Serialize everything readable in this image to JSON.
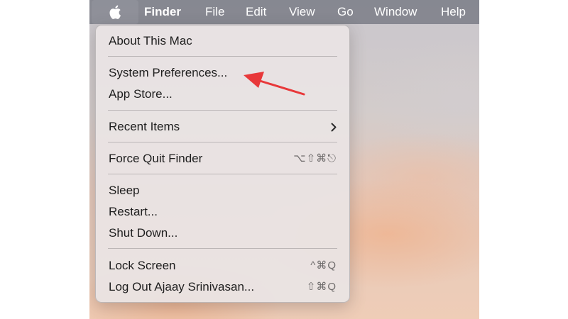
{
  "menubar": {
    "apple_icon": "apple-logo-icon",
    "items": [
      {
        "label": "Finder"
      },
      {
        "label": "File"
      },
      {
        "label": "Edit"
      },
      {
        "label": "View"
      },
      {
        "label": "Go"
      },
      {
        "label": "Window"
      },
      {
        "label": "Help"
      }
    ]
  },
  "apple_menu": {
    "items": [
      {
        "label": "About This Mac",
        "shortcut": ""
      },
      {
        "label": "System Preferences...",
        "shortcut": ""
      },
      {
        "label": "App Store...",
        "shortcut": ""
      },
      {
        "label": "Recent Items",
        "submenu_icon": "chevron-right-icon"
      },
      {
        "label": "Force Quit Finder",
        "shortcut": "⌥⇧⌘⎋"
      },
      {
        "label": "Sleep",
        "shortcut": ""
      },
      {
        "label": "Restart...",
        "shortcut": ""
      },
      {
        "label": "Shut Down...",
        "shortcut": ""
      },
      {
        "label": "Lock Screen",
        "shortcut": "^⌘Q"
      },
      {
        "label": "Log Out Ajaay Srinivasan...",
        "shortcut": "⇧⌘Q"
      }
    ]
  },
  "annotation": {
    "arrow_color": "#e8383a",
    "arrow_icon": "red-pointer-arrow-icon"
  }
}
